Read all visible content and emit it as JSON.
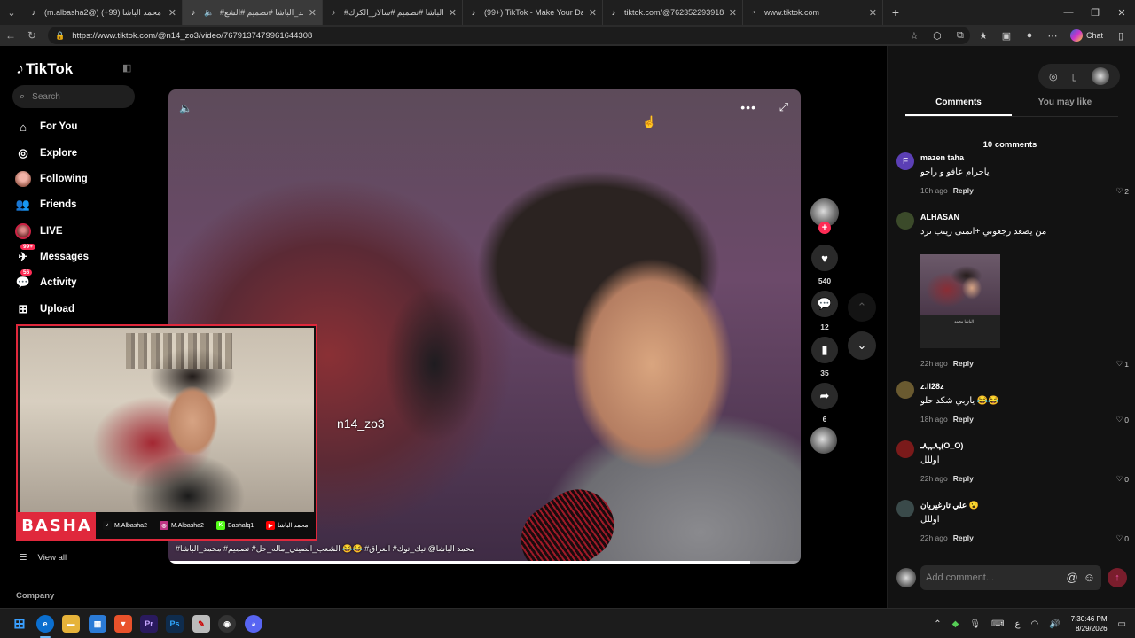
{
  "browser": {
    "tabs": [
      {
        "title": "(m.albasha2@) محمد الباشا (99+)",
        "favicon": "♪",
        "active": false
      },
      {
        "title": "#محمد_الباشا #تصميم #الشع…",
        "favicon": "♪",
        "active": true
      },
      {
        "title": "#محمد_الباشا #تصميم #سالار_الكرك…",
        "favicon": "♪",
        "active": false
      },
      {
        "title": "(99+) TikTok - Make Your Day",
        "favicon": "♪",
        "active": false
      },
      {
        "title": "tiktok.com/@762352293918630…",
        "favicon": "♪",
        "active": false
      },
      {
        "title": "www.tiktok.com",
        "favicon": "◔",
        "active": false
      }
    ],
    "url": "https://www.tiktok.com/@n14_zo3/video/7679137479961644308",
    "chat_label": "Chat"
  },
  "sidebar": {
    "logo": "TikTok",
    "search_placeholder": "Search",
    "items": [
      {
        "label": "For You",
        "icon": "home-icon",
        "glyph": "⌂"
      },
      {
        "label": "Explore",
        "icon": "compass-icon",
        "glyph": "◎"
      },
      {
        "label": "Following",
        "icon": "avatar",
        "glyph": ""
      },
      {
        "label": "Friends",
        "icon": "friends-icon",
        "glyph": "👥"
      },
      {
        "label": "LIVE",
        "icon": "live-avatar",
        "glyph": ""
      },
      {
        "label": "Messages",
        "icon": "messages-icon",
        "glyph": "✈",
        "badge": "99+"
      },
      {
        "label": "Activity",
        "icon": "activity-icon",
        "glyph": "💬",
        "badge": "56"
      },
      {
        "label": "Upload",
        "icon": "upload-icon",
        "glyph": "⊞"
      }
    ],
    "view_all": "View all",
    "company": "Company"
  },
  "video": {
    "overlay_username": "n14_zo3",
    "caption": "محمد الباشا@ تيك_توك# العراق# 😂😂 الشعب_الصيني_ماله_حل# تصميم# محمد_الباشا#",
    "progress": 0.92,
    "likes": "540",
    "comments": "12",
    "saves": "35",
    "shares": "6"
  },
  "webcam": {
    "brand": "BASHA",
    "socials": [
      {
        "name": "M.Albasha2",
        "icon": "tiktok-icon",
        "glyph": "♪",
        "color": "#111111"
      },
      {
        "name": "M.Albasha2",
        "icon": "instagram-icon",
        "glyph": "◎",
        "color": "#c13584"
      },
      {
        "name": "Bashalq1",
        "icon": "kick-icon",
        "glyph": "K",
        "color": "#53fc18"
      },
      {
        "name": "محمد الباشا",
        "icon": "youtube-icon",
        "glyph": "▶",
        "color": "#ff0000"
      }
    ]
  },
  "panel": {
    "tabs": [
      "Comments",
      "You may like"
    ],
    "comment_count": "10 comments",
    "comments": [
      {
        "name": "mazen taha",
        "text": "ياحرام عافو و راحو",
        "time": "10h ago",
        "likes": "2",
        "avatar_letter": "F",
        "avatar_color": "#5b3fb5"
      },
      {
        "name": "ALHASAN",
        "text": "من يصعد رجعوني +اتمنى زيتب ترد",
        "time": "22h ago",
        "likes": "1",
        "avatar_letter": "",
        "avatar_color": "#3b4a2a"
      },
      {
        "name": "z.ll28z",
        "text": "ياربي شكد حلو 😂😂",
        "time": "18h ago",
        "likes": "0",
        "avatar_letter": "",
        "avatar_color": "#6a5a30"
      },
      {
        "name": "ﮩ٨ـﮩﮩ٨ـ(O_O)",
        "text": "اوللل",
        "time": "22h ago",
        "likes": "0",
        "avatar_letter": "",
        "avatar_color": "#7a1a1a"
      },
      {
        "name": "علي تارغيريان 😮",
        "text": "اوللل",
        "time": "22h ago",
        "likes": "0",
        "avatar_letter": "",
        "avatar_color": "#3a4a4a"
      }
    ],
    "thumb_label": "ﺍﻟﺒﺎﺷﺎ ﻣﺤﻤﺪ",
    "reply_label": "Reply",
    "add_comment_placeholder": "Add comment..."
  },
  "taskbar": {
    "time": "7:30:46 PM",
    "date": "8/29/2026",
    "lang": "ع"
  }
}
